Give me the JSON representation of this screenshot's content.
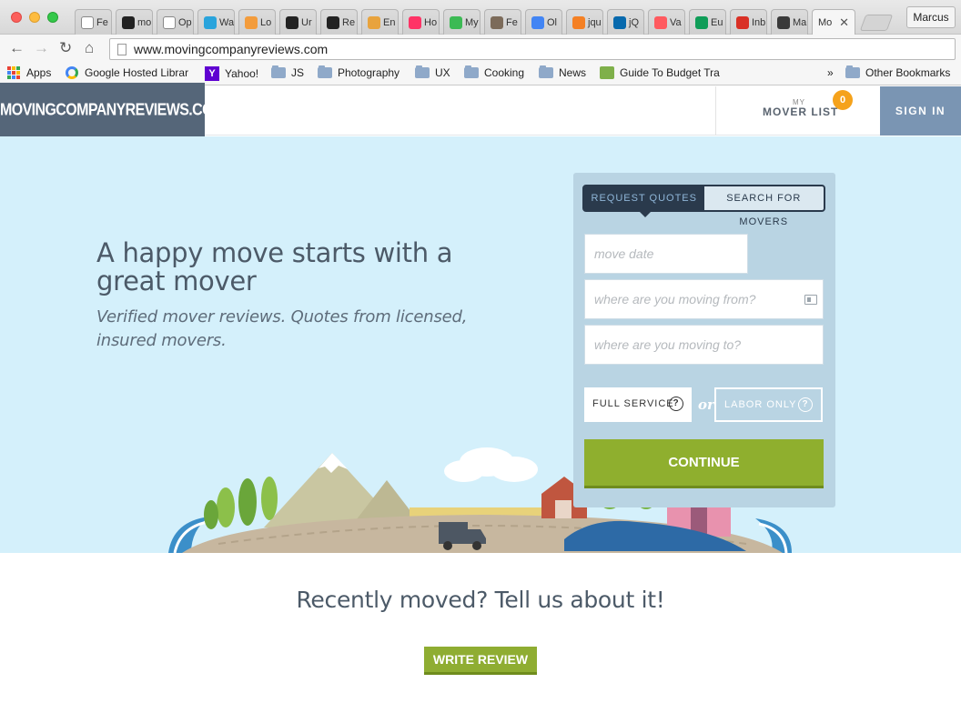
{
  "browser": {
    "tabs": [
      {
        "label": "Fe",
        "icon": "page-icon",
        "color": "#ffffff"
      },
      {
        "label": "mo",
        "icon": "k-logo-icon",
        "color": "#222222"
      },
      {
        "label": "Op",
        "icon": "page-icon",
        "color": "#ffffff"
      },
      {
        "label": "Wa",
        "icon": "play-icon",
        "color": "#2aa4dc"
      },
      {
        "label": "Lo",
        "icon": "circle-logo-icon",
        "color": "#f39c3c"
      },
      {
        "label": "Ur",
        "icon": "camera-icon",
        "color": "#222222"
      },
      {
        "label": "Re",
        "icon": "house-icon",
        "color": "#222222"
      },
      {
        "label": "En",
        "icon": "color-wheel-icon",
        "color": "#e8a33d"
      },
      {
        "label": "Ho",
        "icon": "invision-icon",
        "color": "#ff3366"
      },
      {
        "label": "My",
        "icon": "drive-icon",
        "color": "#3cba54"
      },
      {
        "label": "Fe",
        "icon": "mailchimp-icon",
        "color": "#7c6b5a"
      },
      {
        "label": "Ol",
        "icon": "docs-icon",
        "color": "#4285f4"
      },
      {
        "label": "jqu",
        "icon": "stack-icon",
        "color": "#f48024"
      },
      {
        "label": "jQ",
        "icon": "jquery-icon",
        "color": "#0769ad"
      },
      {
        "label": "Va",
        "icon": "airbnb-icon",
        "color": "#ff5a5f"
      },
      {
        "label": "Eu",
        "icon": "sheets-icon",
        "color": "#0f9d58"
      },
      {
        "label": "Inb",
        "icon": "gmail-icon",
        "color": "#d93025"
      },
      {
        "label": "Ma",
        "icon": "star-icon",
        "color": "#3a3a3a"
      }
    ],
    "active_tab": {
      "label": "Mo",
      "close": "✕"
    },
    "profile": "Marcus",
    "url": "www.movingcompanyreviews.com",
    "nav": {
      "back": "←",
      "forward": "→",
      "reload": "↻",
      "home": "⌂"
    },
    "bookmarks": {
      "apps": "Apps",
      "google_hosted": "Google Hosted Librar",
      "yahoo": "Yahoo!",
      "js": "JS",
      "photography": "Photography",
      "ux": "UX",
      "cooking": "Cooking",
      "news": "News",
      "budget": "Guide To Budget Tra",
      "more": "»",
      "other": "Other Bookmarks"
    }
  },
  "header": {
    "logo": "MOVINGCOMPANYREVIEWS.COM",
    "my": "MY",
    "mover_list": "MOVER LIST",
    "mover_count": "0",
    "sign_in": "SIGN IN"
  },
  "hero": {
    "headline": "A happy move starts with a great mover",
    "subline": "Verified mover reviews. Quotes from licensed, insured movers."
  },
  "quote_form": {
    "tab_request": "REQUEST QUOTES",
    "tab_search": "SEARCH FOR MOVERS",
    "move_date_placeholder": "move date",
    "from_placeholder": "where are you moving from?",
    "to_placeholder": "where are you moving to?",
    "full_service": "FULL SERVICE",
    "or": "or",
    "labor_only": "LABOR ONLY",
    "help": "?",
    "continue": "CONTINUE"
  },
  "review": {
    "prompt": "Recently moved? Tell us about it!",
    "button": "WRITE REVIEW"
  },
  "colors": {
    "brand_dark": "#556679",
    "sign_in": "#7a95b3",
    "hero_bg": "#d4f0fb",
    "panel_bg": "#b9d4e3",
    "accent_green": "#8faf2e",
    "badge_orange": "#f5a21b"
  }
}
